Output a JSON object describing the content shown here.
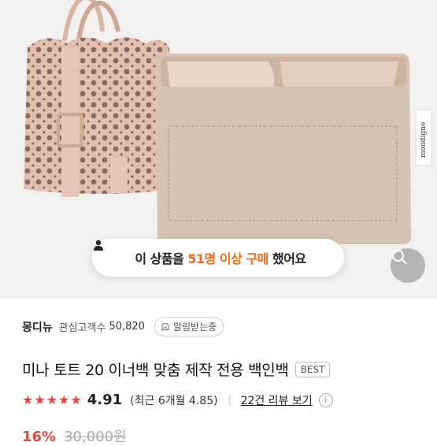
{
  "product": {
    "banner": {
      "pre": "이 상품을 ",
      "count": "51명 이상 구매",
      "post": " 했어요"
    },
    "store_name": "몽디뉴",
    "fav_label": "관심고객수",
    "fav_count": "50,820",
    "alarm_label": "알림받는중",
    "title": "미나 토트 20 이너백 맞춤 제작 전용 백인백",
    "badge": "BEST",
    "rating": "4.91",
    "recent_rating": "(최근 6개월 4.85)",
    "review_link": "22건 리뷰 보기",
    "info_glyph": "i",
    "discount": "16%",
    "original_price": "30,000원",
    "stars": 5,
    "accent_color": "#e8453c",
    "highlight_color": "#f26a1b",
    "insert_brand": "mondigne"
  }
}
